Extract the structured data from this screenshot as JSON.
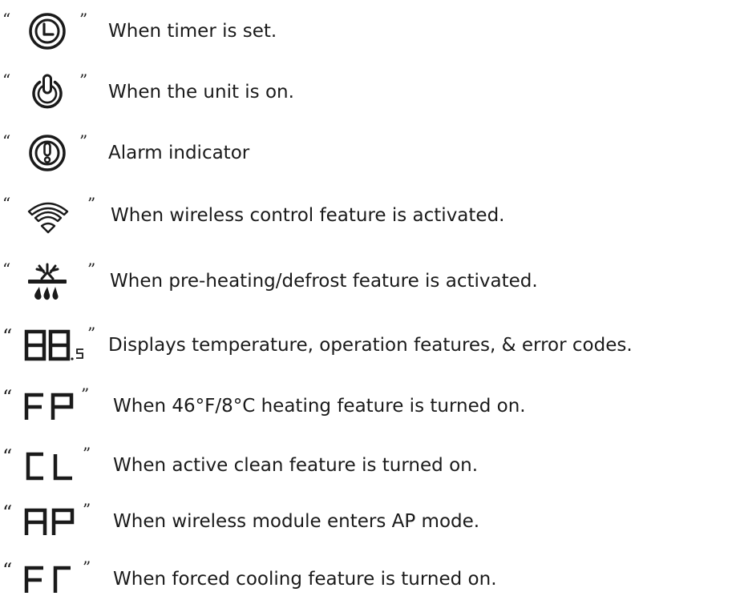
{
  "quote_open": "“",
  "quote_close": "”",
  "indicators": [
    {
      "icon": "timer-icon",
      "text": "When timer is set."
    },
    {
      "icon": "power-icon",
      "text": "When the unit is on."
    },
    {
      "icon": "alarm-icon",
      "text": "Alarm indicator"
    },
    {
      "icon": "wifi-icon",
      "text": "When wireless control feature is activated."
    },
    {
      "icon": "defrost-icon",
      "text": "When pre-heating/defrost feature is activated."
    },
    {
      "icon": "seven-segment-88-icon",
      "display": "88.5",
      "text": "Displays temperature, operation features, & error codes."
    },
    {
      "icon": "seven-segment-fp-icon",
      "display": "FP",
      "text": "When 46°F/8°C heating feature is turned on."
    },
    {
      "icon": "seven-segment-cl-icon",
      "display": "CL",
      "text": "When active clean feature is turned on."
    },
    {
      "icon": "seven-segment-ap-icon",
      "display": "AP",
      "text": "When wireless module enters AP mode."
    },
    {
      "icon": "seven-segment-fc-icon",
      "display": "FC",
      "text": "When forced cooling feature is turned on."
    }
  ]
}
